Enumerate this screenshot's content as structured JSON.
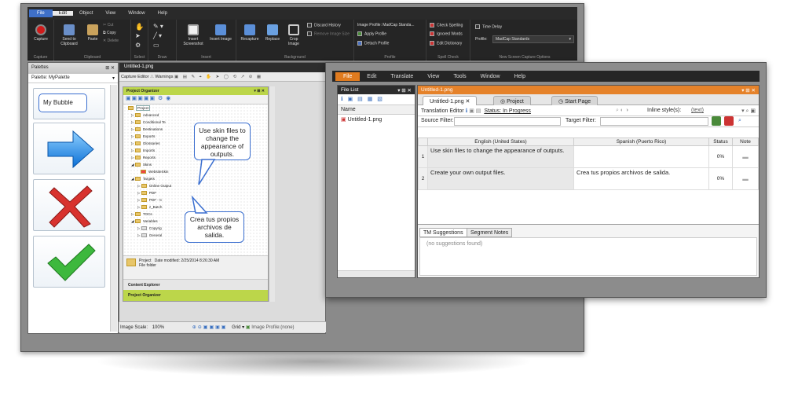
{
  "capture": {
    "menu": [
      "File",
      "Edit",
      "Object",
      "View",
      "Window",
      "Help"
    ],
    "ribbon": {
      "capture_label": "Capture",
      "send_label": "Send to Clipboard",
      "paste_label": "Paste",
      "cut_label": "Cut",
      "copy_label": "Copy",
      "delete_label": "Delete",
      "insert_screenshot": "Insert Screenshot",
      "insert_image": "Insert Image",
      "recapture": "Recapture",
      "replace": "Replace",
      "crop_image": "Crop Image",
      "discard_history": "Discard History",
      "remove_image_size": "Remove Image Size",
      "image_profile": "Image Profile: MadCap Standa...",
      "apply_profile": "Apply Profile",
      "detach_profile": "Detach Profile",
      "check_spelling": "Check Spelling",
      "ignored_words": "Ignored Words",
      "edit_dictionary": "Edit Dictionary",
      "time_delay": "Time Delay",
      "profile_label": "Profile:",
      "profile_value": "MadCap Standards",
      "groups": [
        "Capture",
        "Clipboard",
        "Select",
        "Draw",
        "Insert",
        "Background",
        "Profile",
        "Spell Check",
        "New Screen Capture Options"
      ]
    },
    "palettes": {
      "title": "Palettes",
      "selected": "Palette: MyPalette",
      "bubble_text": "My Bubble"
    },
    "editor": {
      "file_tab": "Untitled-1.png",
      "toolbar_capture": "Capture Editor",
      "toolbar_warnings": "Warnings",
      "image_scale_label": "Image Scale:",
      "image_scale_value": "100%",
      "grid_label": "Grid",
      "image_profile": "Image Profile:(none)"
    },
    "project_organizer": {
      "title": "Project Organizer",
      "root": "Project",
      "items": [
        "Advanced",
        "Conditional Te",
        "Destinations",
        "Exports",
        "Glossaries",
        "Imports",
        "Reports",
        "Skins",
        "WebsiteSkin",
        "Targets",
        "Online Output",
        "PDF",
        "PDF - C",
        "z_Batch",
        "TOCs",
        "Variables",
        "Copyrig",
        "General"
      ],
      "footer_name": "Project",
      "footer_modified": "Date modified:  2/25/2014 8:26:30 AM",
      "footer_type": "File folder",
      "content_explorer": "Content Explorer",
      "project_organizer_bar": "Project Organizer"
    },
    "callouts": {
      "skin": "Use skin files to change the appearance of outputs.",
      "output": "Crea tus propios archivos de salida."
    }
  },
  "lingo": {
    "menu": [
      "File",
      "Edit",
      "Translate",
      "View",
      "Tools",
      "Window",
      "Help"
    ],
    "file_list": {
      "title": "File List",
      "column": "Name",
      "file": "Untitled-1.png"
    },
    "editor": {
      "title": "Untitled-1.png",
      "tabs": [
        "Untitled-1.png",
        "Project",
        "Start Page"
      ],
      "toolbar_label": "Translation Editor",
      "status_label": "Status: In Progress",
      "inline_styles": "Inline style(s):",
      "inline_text": "(text)",
      "source_filter": "Source Filter:",
      "target_filter": "Target Filter:"
    },
    "grid": {
      "columns": [
        "",
        "English (United States)",
        "Spanish (Puerto Rico)",
        "Status",
        "Note"
      ],
      "rows": [
        {
          "num": "1",
          "source": "Use skin files to change the appearance of outputs.",
          "target": "",
          "status": "0%"
        },
        {
          "num": "2",
          "source": "Create your own output files.",
          "target": "Crea tus propios archivos de salida.",
          "status": "0%"
        }
      ]
    },
    "bottom": {
      "tab1": "TM Suggestions",
      "tab2": "Segment Notes",
      "empty": "(no suggestions found)"
    }
  },
  "colors": {
    "capture_file": "#3f70c8",
    "lingo_file": "#e07b1f",
    "organizer_green": "#bcd64a",
    "callout_blue": "#3b6fd0"
  }
}
